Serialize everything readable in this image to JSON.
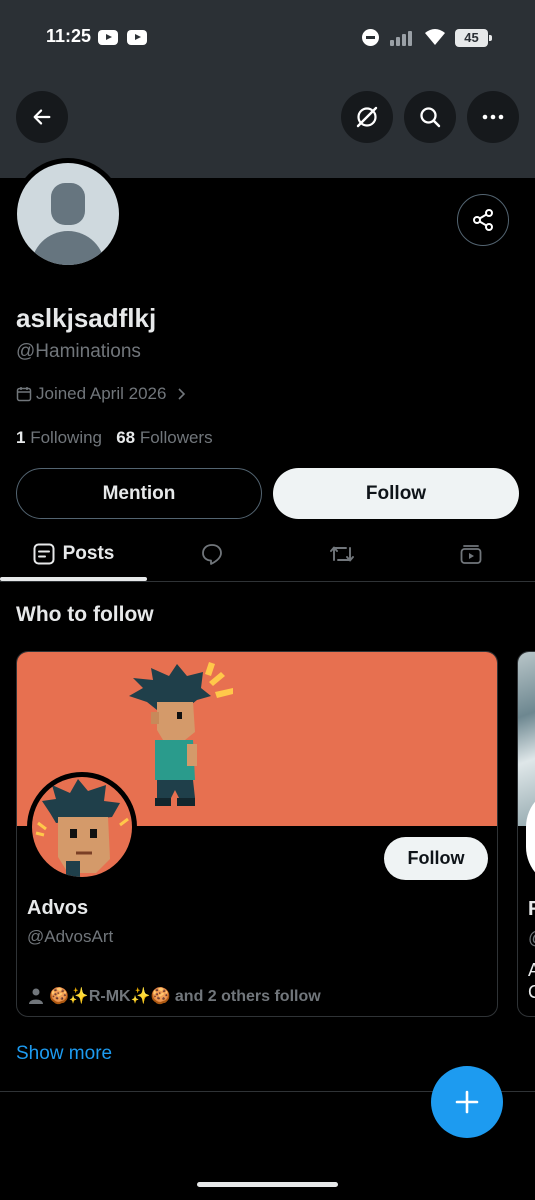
{
  "status_bar": {
    "time": "11:25",
    "battery": "45"
  },
  "profile": {
    "display_name": "aslkjsadflkj",
    "handle": "@Haminations",
    "joined": "Joined April 2026",
    "following_count": "1",
    "following_label": "Following",
    "followers_count": "68",
    "followers_label": "Followers"
  },
  "actions": {
    "mention_label": "Mention",
    "follow_label": "Follow"
  },
  "tabs": [
    {
      "label": "Posts",
      "icon": "posts-icon",
      "selected": true
    },
    {
      "label": "",
      "icon": "replies-icon",
      "selected": false
    },
    {
      "label": "",
      "icon": "repost-icon",
      "selected": false
    },
    {
      "label": "",
      "icon": "media-icon",
      "selected": false
    }
  ],
  "who_to_follow": {
    "title": "Who to follow",
    "cards": [
      {
        "name": "Advos",
        "handle": "@AdvosArt",
        "follow_label": "Follow",
        "social_context": "🍪✨R-MK✨🍪 and 2 others follow"
      },
      {
        "name": "F",
        "handle": "@",
        "bio": "A",
        "bio2": "C"
      }
    ],
    "show_more": "Show more"
  },
  "colors": {
    "accent": "#1d9bf0",
    "header_bg": "#2b3035",
    "banner": "#e77050"
  }
}
